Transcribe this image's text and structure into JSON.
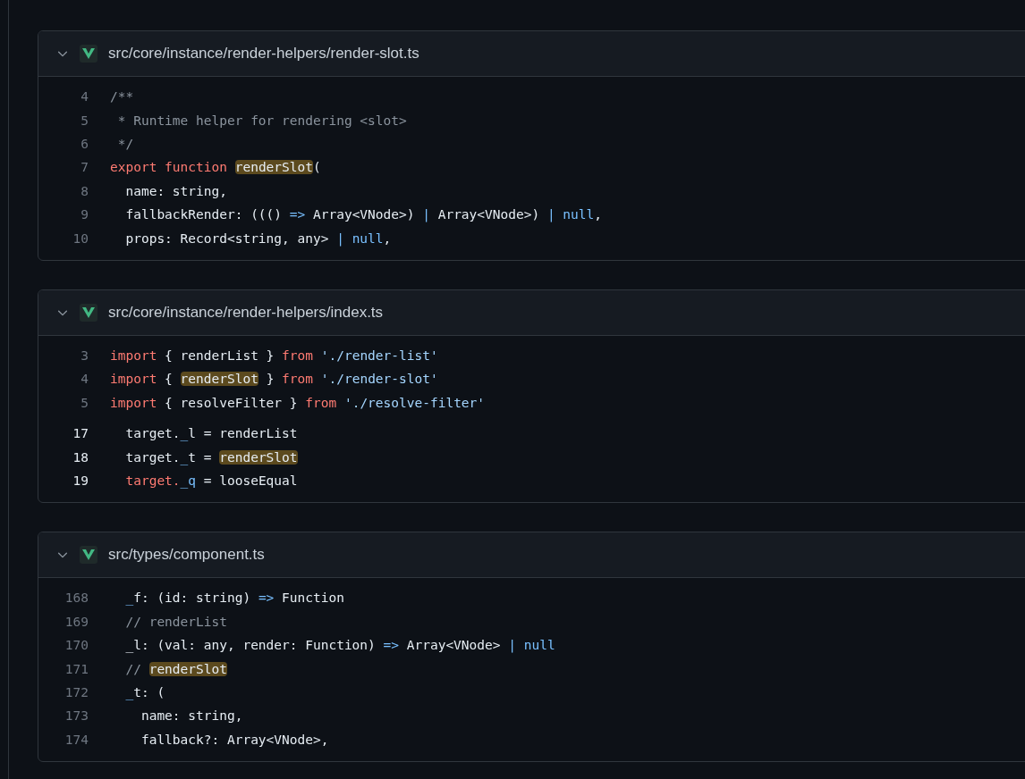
{
  "files": [
    {
      "path": "src/core/instance/render-helpers/render-slot.ts",
      "expanded": true,
      "hunks": [
        {
          "lines": [
            {
              "number": "4",
              "bright": false,
              "tokens": [
                {
                  "kind": "comment",
                  "text": "/**"
                }
              ]
            },
            {
              "number": "5",
              "bright": false,
              "tokens": [
                {
                  "kind": "comment",
                  "text": " * Runtime helper for rendering <slot>"
                }
              ]
            },
            {
              "number": "6",
              "bright": false,
              "tokens": [
                {
                  "kind": "comment",
                  "text": " */"
                }
              ]
            },
            {
              "number": "7",
              "bright": false,
              "tokens": [
                {
                  "kind": "keyword",
                  "text": "export function "
                },
                {
                  "kind": "match",
                  "text": "renderSlot"
                },
                {
                  "kind": "plain",
                  "text": "("
                }
              ]
            },
            {
              "number": "8",
              "bright": false,
              "tokens": [
                {
                  "kind": "plain",
                  "text": "  name: string,"
                }
              ]
            },
            {
              "number": "9",
              "bright": false,
              "tokens": [
                {
                  "kind": "plain",
                  "text": "  fallbackRender: ((() "
                },
                {
                  "kind": "operator",
                  "text": "=>"
                },
                {
                  "kind": "plain",
                  "text": " Array<VNode>) "
                },
                {
                  "kind": "operator",
                  "text": "|"
                },
                {
                  "kind": "plain",
                  "text": " Array<VNode>) "
                },
                {
                  "kind": "operator",
                  "text": "| null"
                },
                {
                  "kind": "plain",
                  "text": ","
                }
              ]
            },
            {
              "number": "10",
              "bright": false,
              "tokens": [
                {
                  "kind": "plain",
                  "text": "  props: Record<string, any> "
                },
                {
                  "kind": "operator",
                  "text": "| null"
                },
                {
                  "kind": "plain",
                  "text": ","
                }
              ]
            }
          ]
        }
      ]
    },
    {
      "path": "src/core/instance/render-helpers/index.ts",
      "expanded": true,
      "hunks": [
        {
          "lines": [
            {
              "number": "3",
              "bright": false,
              "tokens": [
                {
                  "kind": "keyword",
                  "text": "import"
                },
                {
                  "kind": "plain",
                  "text": " { renderList } "
                },
                {
                  "kind": "keyword",
                  "text": "from"
                },
                {
                  "kind": "string",
                  "text": " './render-list'"
                }
              ]
            },
            {
              "number": "4",
              "bright": false,
              "tokens": [
                {
                  "kind": "keyword",
                  "text": "import"
                },
                {
                  "kind": "plain",
                  "text": " { "
                },
                {
                  "kind": "match",
                  "text": "renderSlot"
                },
                {
                  "kind": "plain",
                  "text": " } "
                },
                {
                  "kind": "keyword",
                  "text": "from"
                },
                {
                  "kind": "string",
                  "text": " './render-slot'"
                }
              ]
            },
            {
              "number": "5",
              "bright": false,
              "tokens": [
                {
                  "kind": "keyword",
                  "text": "import"
                },
                {
                  "kind": "plain",
                  "text": " { resolveFilter } "
                },
                {
                  "kind": "keyword",
                  "text": "from"
                },
                {
                  "kind": "string",
                  "text": " './resolve-filter'"
                }
              ]
            }
          ]
        },
        {
          "lines": [
            {
              "number": "17",
              "bright": true,
              "tokens": [
                {
                  "kind": "plain",
                  "text": "  target."
                },
                {
                  "kind": "operator",
                  "text": "_"
                },
                {
                  "kind": "plain",
                  "text": "l = renderList"
                }
              ]
            },
            {
              "number": "18",
              "bright": true,
              "tokens": [
                {
                  "kind": "plain",
                  "text": "  target."
                },
                {
                  "kind": "operator",
                  "text": "_"
                },
                {
                  "kind": "plain",
                  "text": "t = "
                },
                {
                  "kind": "match",
                  "text": "renderSlot"
                }
              ]
            },
            {
              "number": "19",
              "bright": true,
              "tokens": [
                {
                  "kind": "keyword",
                  "text": "  target."
                },
                {
                  "kind": "operator",
                  "text": "_q"
                },
                {
                  "kind": "plain",
                  "text": " = looseEqual"
                }
              ]
            }
          ]
        }
      ]
    },
    {
      "path": "src/types/component.ts",
      "expanded": true,
      "hunks": [
        {
          "lines": [
            {
              "number": "168",
              "bright": false,
              "tokens": [
                {
                  "kind": "operator",
                  "text": "  _"
                },
                {
                  "kind": "plain",
                  "text": "f: (id: string) "
                },
                {
                  "kind": "operator",
                  "text": "=>"
                },
                {
                  "kind": "plain",
                  "text": " Function"
                }
              ]
            },
            {
              "number": "169",
              "bright": false,
              "tokens": [
                {
                  "kind": "comment",
                  "text": "  // renderList"
                }
              ]
            },
            {
              "number": "170",
              "bright": false,
              "tokens": [
                {
                  "kind": "plain",
                  "text": "  _l: (val: any, render: Function) "
                },
                {
                  "kind": "operator",
                  "text": "=>"
                },
                {
                  "kind": "plain",
                  "text": " Array<VNode> "
                },
                {
                  "kind": "operator",
                  "text": "| null"
                }
              ]
            },
            {
              "number": "171",
              "bright": false,
              "tokens": [
                {
                  "kind": "comment",
                  "text": "  // "
                },
                {
                  "kind": "match",
                  "text": "renderSlot"
                }
              ]
            },
            {
              "number": "172",
              "bright": false,
              "tokens": [
                {
                  "kind": "operator",
                  "text": "  _"
                },
                {
                  "kind": "plain",
                  "text": "t: ("
                }
              ]
            },
            {
              "number": "173",
              "bright": false,
              "tokens": [
                {
                  "kind": "plain",
                  "text": "    name: string,"
                }
              ]
            },
            {
              "number": "174",
              "bright": false,
              "tokens": [
                {
                  "kind": "plain",
                  "text": "    fallback?: Array<VNode>,"
                }
              ]
            }
          ]
        }
      ]
    }
  ]
}
